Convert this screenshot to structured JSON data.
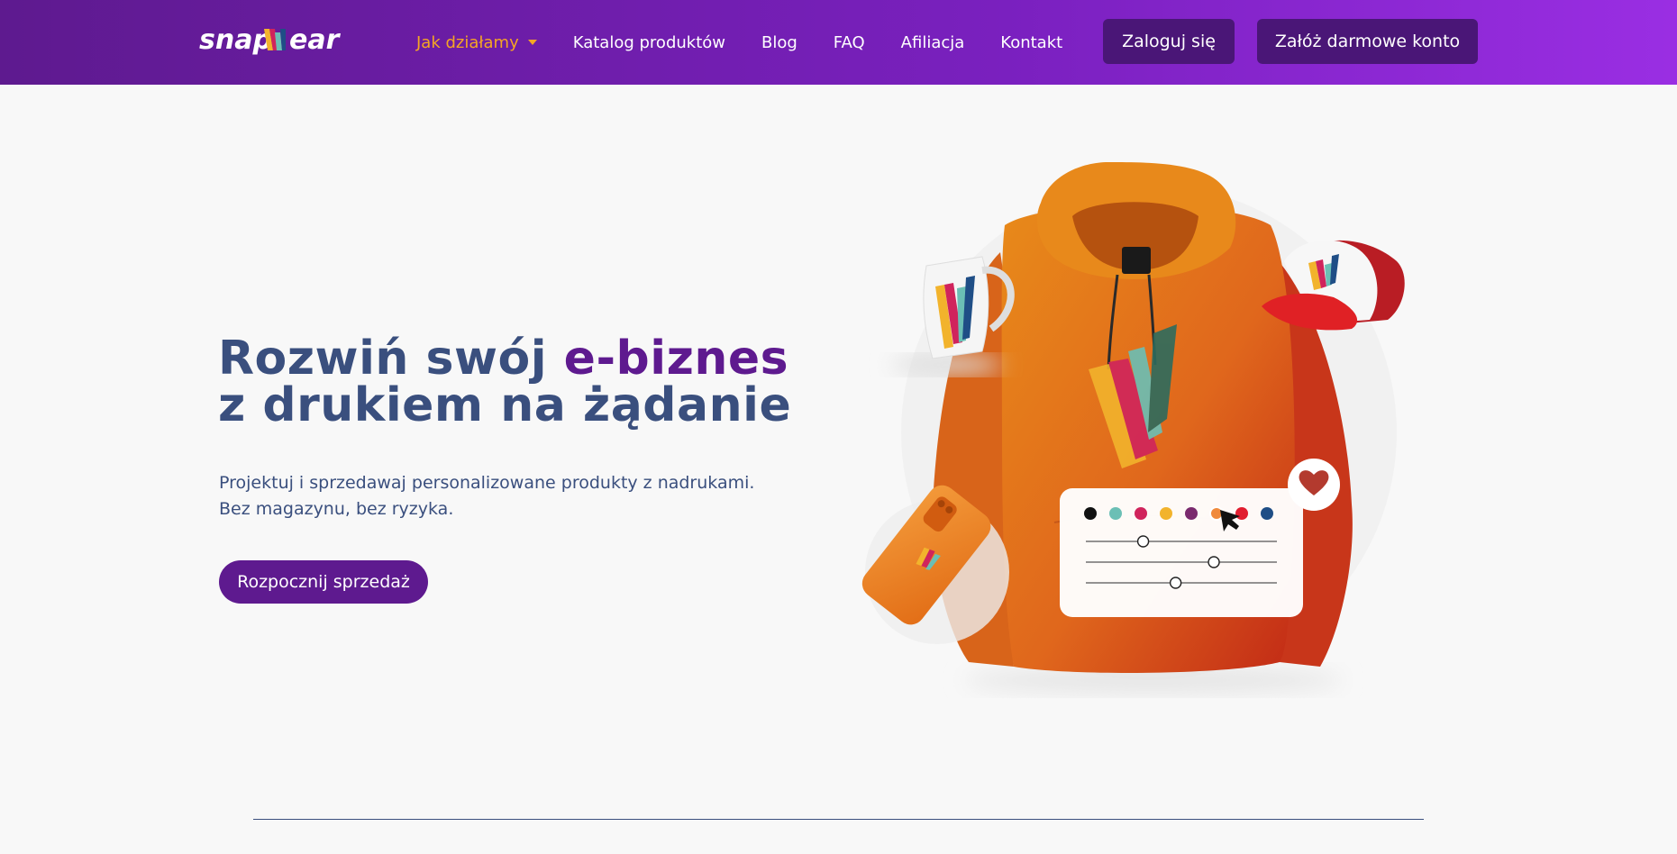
{
  "brand": {
    "logo_text_left": "snap",
    "logo_text_right": "ear",
    "colors": {
      "purple": "#5e1a8f",
      "accent_orange": "#f5a623",
      "navy": "#3a4f7e"
    }
  },
  "nav": {
    "items": [
      {
        "label": "Jak działamy",
        "active": true,
        "has_dropdown": true
      },
      {
        "label": "Katalog produktów"
      },
      {
        "label": "Blog"
      },
      {
        "label": "FAQ"
      },
      {
        "label": "Afiliacja"
      },
      {
        "label": "Kontakt"
      }
    ],
    "login_label": "Zaloguj się",
    "signup_label": "Załóż darmowe konto"
  },
  "hero": {
    "title_part1": "Rozwiń swój ",
    "title_accent": "e-biznes",
    "title_line2": "z drukiem na żądanie",
    "subtitle_line1": "Projektuj i sprzedawaj personalizowane produkty z nadrukami.",
    "subtitle_line2": "Bez magazynu, bez ryzyka.",
    "cta_label": "Rozpocznij sprzedaż"
  },
  "illustration": {
    "products": [
      "mug",
      "hoodie",
      "cap",
      "phone-case"
    ],
    "swatch_colors": [
      "#111111",
      "#6bbfb5",
      "#d0245c",
      "#f2b32c",
      "#7a2a6e",
      "#f08a3c",
      "#e11d2f",
      "#1f4e86"
    ],
    "selected_swatch": 5,
    "slider_levels": [
      0.3,
      0.67,
      0.47
    ]
  }
}
